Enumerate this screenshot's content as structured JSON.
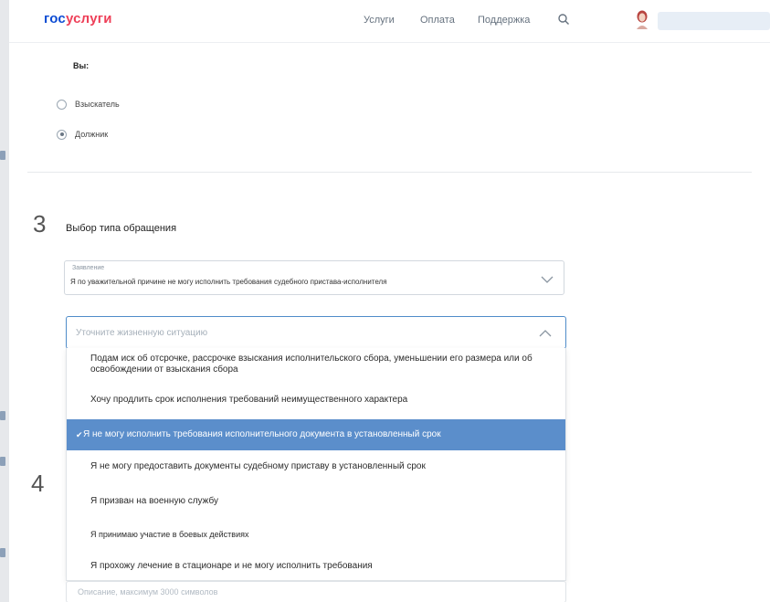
{
  "header": {
    "logo_part1": "гос",
    "logo_part2": "услуги",
    "nav": [
      "Услуги",
      "Оплата",
      "Поддержка"
    ],
    "search_icon": "search-icon",
    "avatar_icon": "user-avatar-icon"
  },
  "role_section": {
    "label": "Вы:",
    "options": [
      {
        "label": "Взыскатель",
        "selected": false
      },
      {
        "label": "Должник",
        "selected": true
      }
    ]
  },
  "step3": {
    "number": "3",
    "title": "Выбор типа обращения",
    "select1": {
      "caption": "Заявление",
      "value": "Я по уважительной причине не могу исполнить требования судебного пристава-исполнителя"
    },
    "select2": {
      "placeholder": "Уточните жизненную ситуацию"
    },
    "dropdown_options": [
      {
        "label": "Подам иск об отсрочке, рассрочке взыскания исполнительского сбора, уменьшении его размера или об освобождении от взыскания сбора",
        "selected": false
      },
      {
        "label": "Хочу продлить срок исполнения требований неимущественного характера",
        "selected": false
      },
      {
        "label": "Я не могу исполнить требования исполнительного документа в установленный срок",
        "selected": true
      },
      {
        "label": "Я не могу предоставить документы судебному приставу в установленный срок",
        "selected": false
      },
      {
        "label": "Я призван на военную службу",
        "selected": false
      },
      {
        "label": "Я принимаю участие в боевых действиях",
        "selected": false
      },
      {
        "label": "Я прохожу лечение в стационаре и не могу исполнить требования",
        "selected": false
      }
    ]
  },
  "step4": {
    "number": "4",
    "textarea_placeholder": "Описание, максимум 3000 символов"
  },
  "colors": {
    "brand_blue": "#0d4cd3",
    "brand_red": "#ee3f58",
    "selected_option": "#5b8ecb",
    "focus_border": "#4f8cc9"
  }
}
